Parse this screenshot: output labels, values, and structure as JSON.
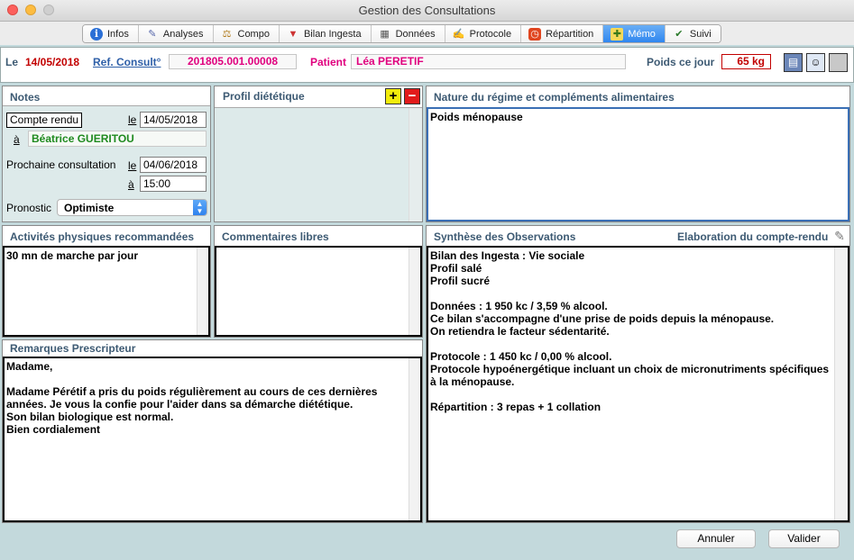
{
  "window": {
    "title": "Gestion des Consultations"
  },
  "tabs": [
    {
      "label": "Infos",
      "icon": "info-icon"
    },
    {
      "label": "Analyses",
      "icon": "syringe-icon"
    },
    {
      "label": "Compo",
      "icon": "scale-icon"
    },
    {
      "label": "Bilan Ingesta",
      "icon": "glass-icon"
    },
    {
      "label": "Données",
      "icon": "table-icon"
    },
    {
      "label": "Protocole",
      "icon": "notepad-icon"
    },
    {
      "label": "Répartition",
      "icon": "clock-icon"
    },
    {
      "label": "Mémo",
      "icon": "memo-icon",
      "active": true
    },
    {
      "label": "Suivi",
      "icon": "check-icon"
    }
  ],
  "header": {
    "le_label": "Le",
    "date": "14/05/2018",
    "ref_label": "Ref. Consult°",
    "ref_value": "201805.001.00008",
    "patient_label": "Patient",
    "patient_value": "Léa PERETIF",
    "weight_label": "Poids ce jour",
    "weight_value": "65 kg"
  },
  "notes": {
    "title": "Notes",
    "compte_rendu_label": "Compte rendu",
    "le_label": "le",
    "compte_rendu_date": "14/05/2018",
    "a_label": "à",
    "destinataire": "Béatrice GUERITOU",
    "prochaine_label": "Prochaine consultation",
    "prochaine_date": "04/06/2018",
    "prochaine_heure": "15:00",
    "pronostic_label": "Pronostic",
    "pronostic_value": "Optimiste"
  },
  "profil": {
    "title": "Profil diététique",
    "add": "+",
    "remove": "−"
  },
  "nature": {
    "title": "Nature du régime et compléments alimentaires",
    "text": "Poids ménopause"
  },
  "activites": {
    "title": "Activités physiques recommandées",
    "text": "30 mn de marche par jour"
  },
  "commentaires": {
    "title": "Commentaires libres",
    "text": ""
  },
  "synthese": {
    "title": "Synthèse des Observations",
    "elaboration": "Elaboration du compte-rendu",
    "text": "Bilan des Ingesta : Vie sociale\nProfil salé\nProfil sucré\n\nDonnées : 1 950 kc / 3,59 % alcool.\nCe bilan s'accompagne d'une prise de poids depuis la ménopause.\nOn retiendra le facteur sédentarité.\n\nProtocole : 1 450 kc / 0,00 % alcool.\nProtocole hypoénergétique incluant un choix de micronutriments spécifiques\nà la ménopause.\n\nRépartition : 3 repas + 1 collation"
  },
  "remarques": {
    "title": "Remarques Prescripteur",
    "text": "Madame,\n\nMadame Pérétif a pris du poids régulièrement au cours de ces dernières\nannées. Je vous la confie pour l'aider dans sa démarche diététique.\nSon bilan biologique est normal.\nBien cordialement"
  },
  "buttons": {
    "cancel": "Annuler",
    "validate": "Valider"
  }
}
